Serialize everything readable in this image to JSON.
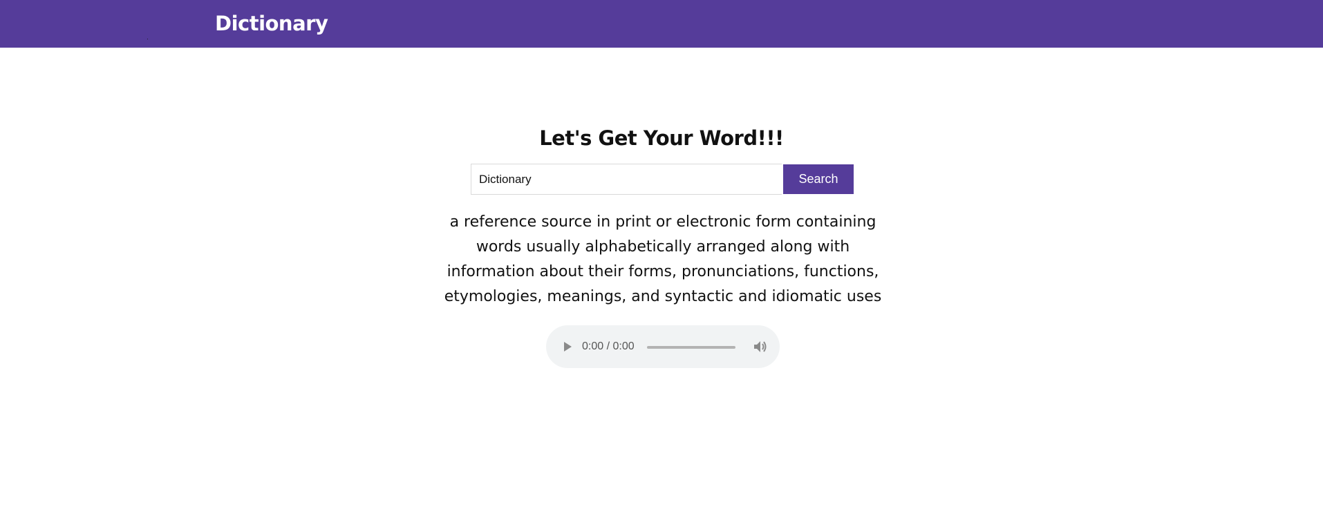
{
  "navbar": {
    "brand": "Dictionary"
  },
  "main": {
    "heading": "Let's Get Your Word!!!",
    "search": {
      "value": "Dictionary",
      "button_label": "Search"
    },
    "definition": "a reference source in print or electronic form containing words usually alphabetically arranged along with information about their forms, pronunciations, functions, etymologies, meanings, and syntactic and idiomatic uses",
    "audio": {
      "time": "0:00 / 0:00",
      "progress": 0,
      "icons": [
        "play-icon",
        "volume-icon"
      ]
    }
  },
  "colors": {
    "brand": "#553c9a",
    "background": "#ffffff",
    "player_background": "#f1f3f4"
  }
}
